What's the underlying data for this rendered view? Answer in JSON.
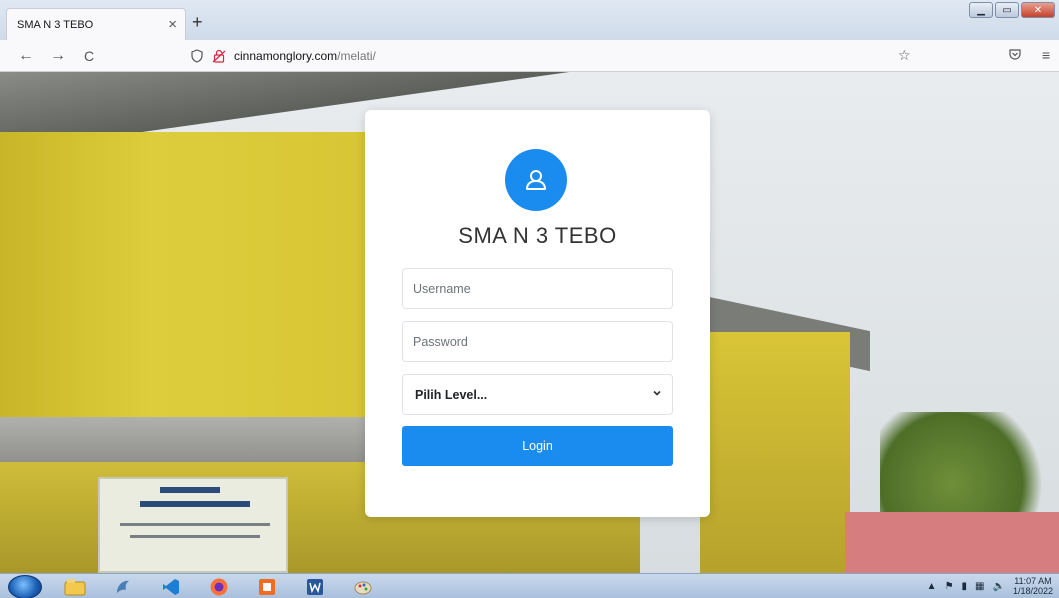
{
  "browser": {
    "tab_title": "SMA N 3 TEBO",
    "tab_close": "×",
    "new_tab": "+",
    "url_host": "cinnamonglory.com",
    "url_path": "/melati/",
    "back": "←",
    "forward": "→",
    "reload": "C"
  },
  "login": {
    "title": "SMA N 3 TEBO",
    "username_placeholder": "Username",
    "password_placeholder": "Password",
    "level_selected": "Pilih Level...",
    "login_label": "Login"
  },
  "colors": {
    "accent": "#1a8cf0",
    "card_bg": "#ffffff"
  },
  "taskbar": {
    "apps": [
      "explorer-icon",
      "dolphin-icon",
      "vscode-icon",
      "firefox-icon",
      "ms-office-icon",
      "word-icon",
      "paint-icon"
    ],
    "clock_time": "11:07 AM",
    "clock_date": "1/18/2022"
  }
}
